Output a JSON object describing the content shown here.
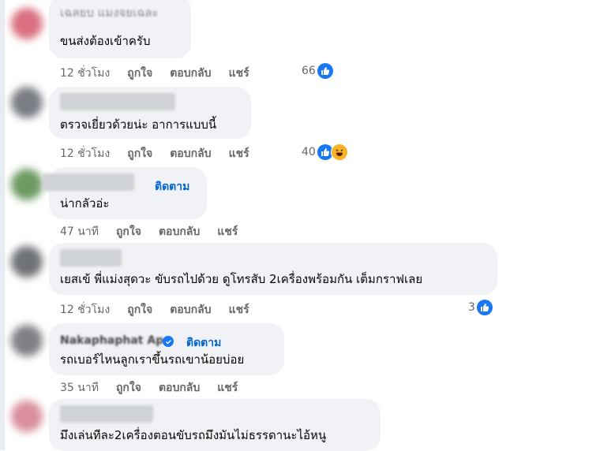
{
  "colors": {
    "bubble": "#f0f2f5",
    "link": "#0064d1",
    "meta": "#65676b",
    "like": "#1877f2"
  },
  "actions": {
    "like": "ถูกใจ",
    "reply": "ตอบกลับ",
    "share": "แชร์"
  },
  "comments": [
    {
      "text_top": "เฉลยบ แมงจยเฉละ",
      "text": "ขนส่งต้องเข้าครับ",
      "time": "12 ชั่วโมง",
      "reactions": "66",
      "reaction_icons": [
        "like-icon"
      ]
    },
    {
      "text": "ตรวจเยี่ยวด้วยน่ะ อาการแบบนี้",
      "time": "12 ชั่วโมง",
      "reactions": "40",
      "reaction_icons": [
        "like-icon",
        "haha-icon"
      ]
    },
    {
      "follow": "ติดตาม",
      "text": "น่ากลัวอ่ะ",
      "time": "47 นาที",
      "reactions": "",
      "reaction_icons": []
    },
    {
      "text": "เยสเข้ พี่แม่งสุดวะ ขับรถไปด้วย ดูโทรสับ 2เครื่องพร้อมกัน เต็มกราฟเลย",
      "time": "12 ชั่วโมง",
      "reactions": "3",
      "reaction_icons": [
        "like-icon"
      ]
    },
    {
      "name": "Nakaphaphat Ap",
      "follow": "ติดตาม",
      "text": "รถเบอร์ไหนลูกเราขึ้นรถเขาน้อยบ่อย",
      "time": "35 นาที",
      "reactions": "",
      "reaction_icons": []
    },
    {
      "text": "มึงเล่นทีละ2เครื่องตอนขับรถมึงมันไม่ธรรดานะไอ้หนู",
      "time": "",
      "reactions": "",
      "reaction_icons": []
    }
  ]
}
